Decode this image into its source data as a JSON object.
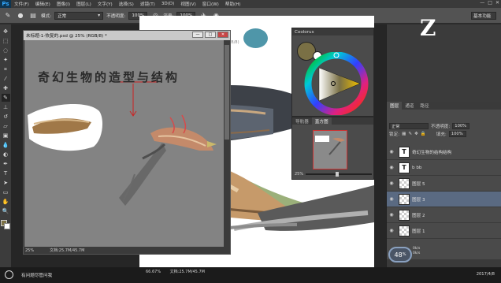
{
  "app": {
    "logo": "Ps"
  },
  "menu": [
    "文件(F)",
    "编辑(E)",
    "图像(I)",
    "图层(L)",
    "文字(Y)",
    "选择(S)",
    "滤镜(T)",
    "3D(D)",
    "视图(V)",
    "窗口(W)",
    "帮助(H)"
  ],
  "options": {
    "mode_label": "模式:",
    "mode_value": "正常",
    "opacity_label": "不透明度:",
    "opacity_value": "100%",
    "flow_label": "流量:",
    "flow_value": "100%",
    "workspace": "基本功能"
  },
  "doc_window": {
    "title": "未标题-1-恢复的.psd @ 25% (RGB/8) *",
    "headline": "奇幻生物的造型与结构",
    "zoom": "25%",
    "doc_size": "文档:25.7M/45.7M"
  },
  "main_canvas": {
    "tab": "(RGB/8)",
    "zoom": "66.67%",
    "doc_size": "文档:25.7M/45.7M"
  },
  "color_panel": {
    "title": "Coolorus",
    "fg_color": "#7a7045",
    "bg_color": "#ffffff"
  },
  "navigator": {
    "tabs": [
      "导航器",
      "直方图"
    ],
    "zoom": "25%"
  },
  "layers": {
    "tabs": [
      "图层",
      "通道",
      "路径"
    ],
    "blend_mode": "正常",
    "opacity_label": "不透明度:",
    "opacity_value": "100%",
    "lock_label": "锁定:",
    "fill_label": "填充:",
    "fill_value": "100%",
    "items": [
      {
        "name": "奇幻生物的结构结构",
        "kind": "text",
        "thumb": "T"
      },
      {
        "name": "b bb",
        "kind": "text",
        "thumb": "T"
      },
      {
        "name": "图层 5",
        "kind": "pixel",
        "thumb": ""
      },
      {
        "name": "图层 3",
        "kind": "pixel",
        "thumb": ""
      },
      {
        "name": "图层 2",
        "kind": "pixel",
        "thumb": ""
      },
      {
        "name": "图层 1",
        "kind": "pixel",
        "thumb": ""
      }
    ]
  },
  "speed_widget": {
    "value": "48",
    "unit": "%",
    "up": "0k/s",
    "down": "0k/s"
  },
  "taskbar": {
    "search_placeholder": "有问题尽管问我",
    "date": "2017/4/8"
  }
}
